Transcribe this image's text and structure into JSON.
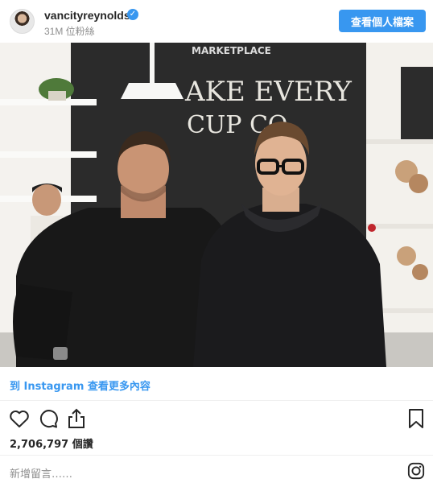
{
  "header": {
    "username": "vancityreynolds",
    "followers": "31M 位粉絲",
    "profile_button": "查看個人檔案"
  },
  "photo": {
    "sign_line1": "MARKETPLACE",
    "sign_line2": "AKE EVERY",
    "sign_line3": "CUP CO"
  },
  "view_more": "到 Instagram 查看更多內容",
  "actions": [
    "heart-icon",
    "comment-icon",
    "share-icon",
    "bookmark-icon"
  ],
  "likes": "2,706,797 個讚",
  "comment_placeholder": "新增留言……",
  "colors": {
    "accent": "#3897f0",
    "text": "#262626",
    "muted": "#8e8e8e"
  }
}
